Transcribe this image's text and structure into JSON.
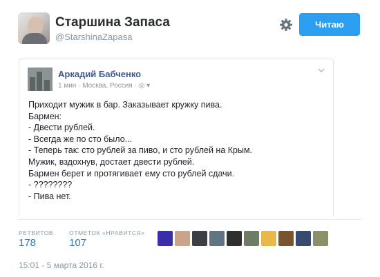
{
  "header": {
    "display_name": "Старшина Запаса",
    "screen_name": "@StarshinaZapasa",
    "gear_icon": "gear-icon",
    "follow_label": "Читаю",
    "follow_color": "#2b9ef0"
  },
  "embedded_post": {
    "author": "Аркадий Бабченко",
    "meta": "1 мин · Москва, Россия · ◎ ▾",
    "chevron_icon": "chevron-down-icon",
    "lines": [
      "Приходит мужик в бар. Заказывает кружку пива.",
      "Бармен:",
      "- Двести рублей.",
      "- Всегда же по сто было...",
      "- Теперь так: сто рублей за пиво, и сто рублей на Крым.",
      "Мужик, вздохнув, достает двести рублей.",
      "Бармен берет и протягивает ему сто рублей сдачи.",
      "- ????????",
      "- Пива нет."
    ]
  },
  "stats": {
    "retweets_label": "РЕТВИТОВ",
    "retweets_value": "178",
    "likes_label": "ОТМЕТОК «НРАВИТСЯ»",
    "likes_value": "107"
  },
  "liker_avatar_colors": [
    "#3a2fa8",
    "#c9a38a",
    "#3b3f45",
    "#5f7380",
    "#2f2f2f",
    "#6e7c65",
    "#e8b94a",
    "#7a5330",
    "#384a70",
    "#8a8f6a"
  ],
  "timestamp": "15:01 - 5 марта 2016 г."
}
